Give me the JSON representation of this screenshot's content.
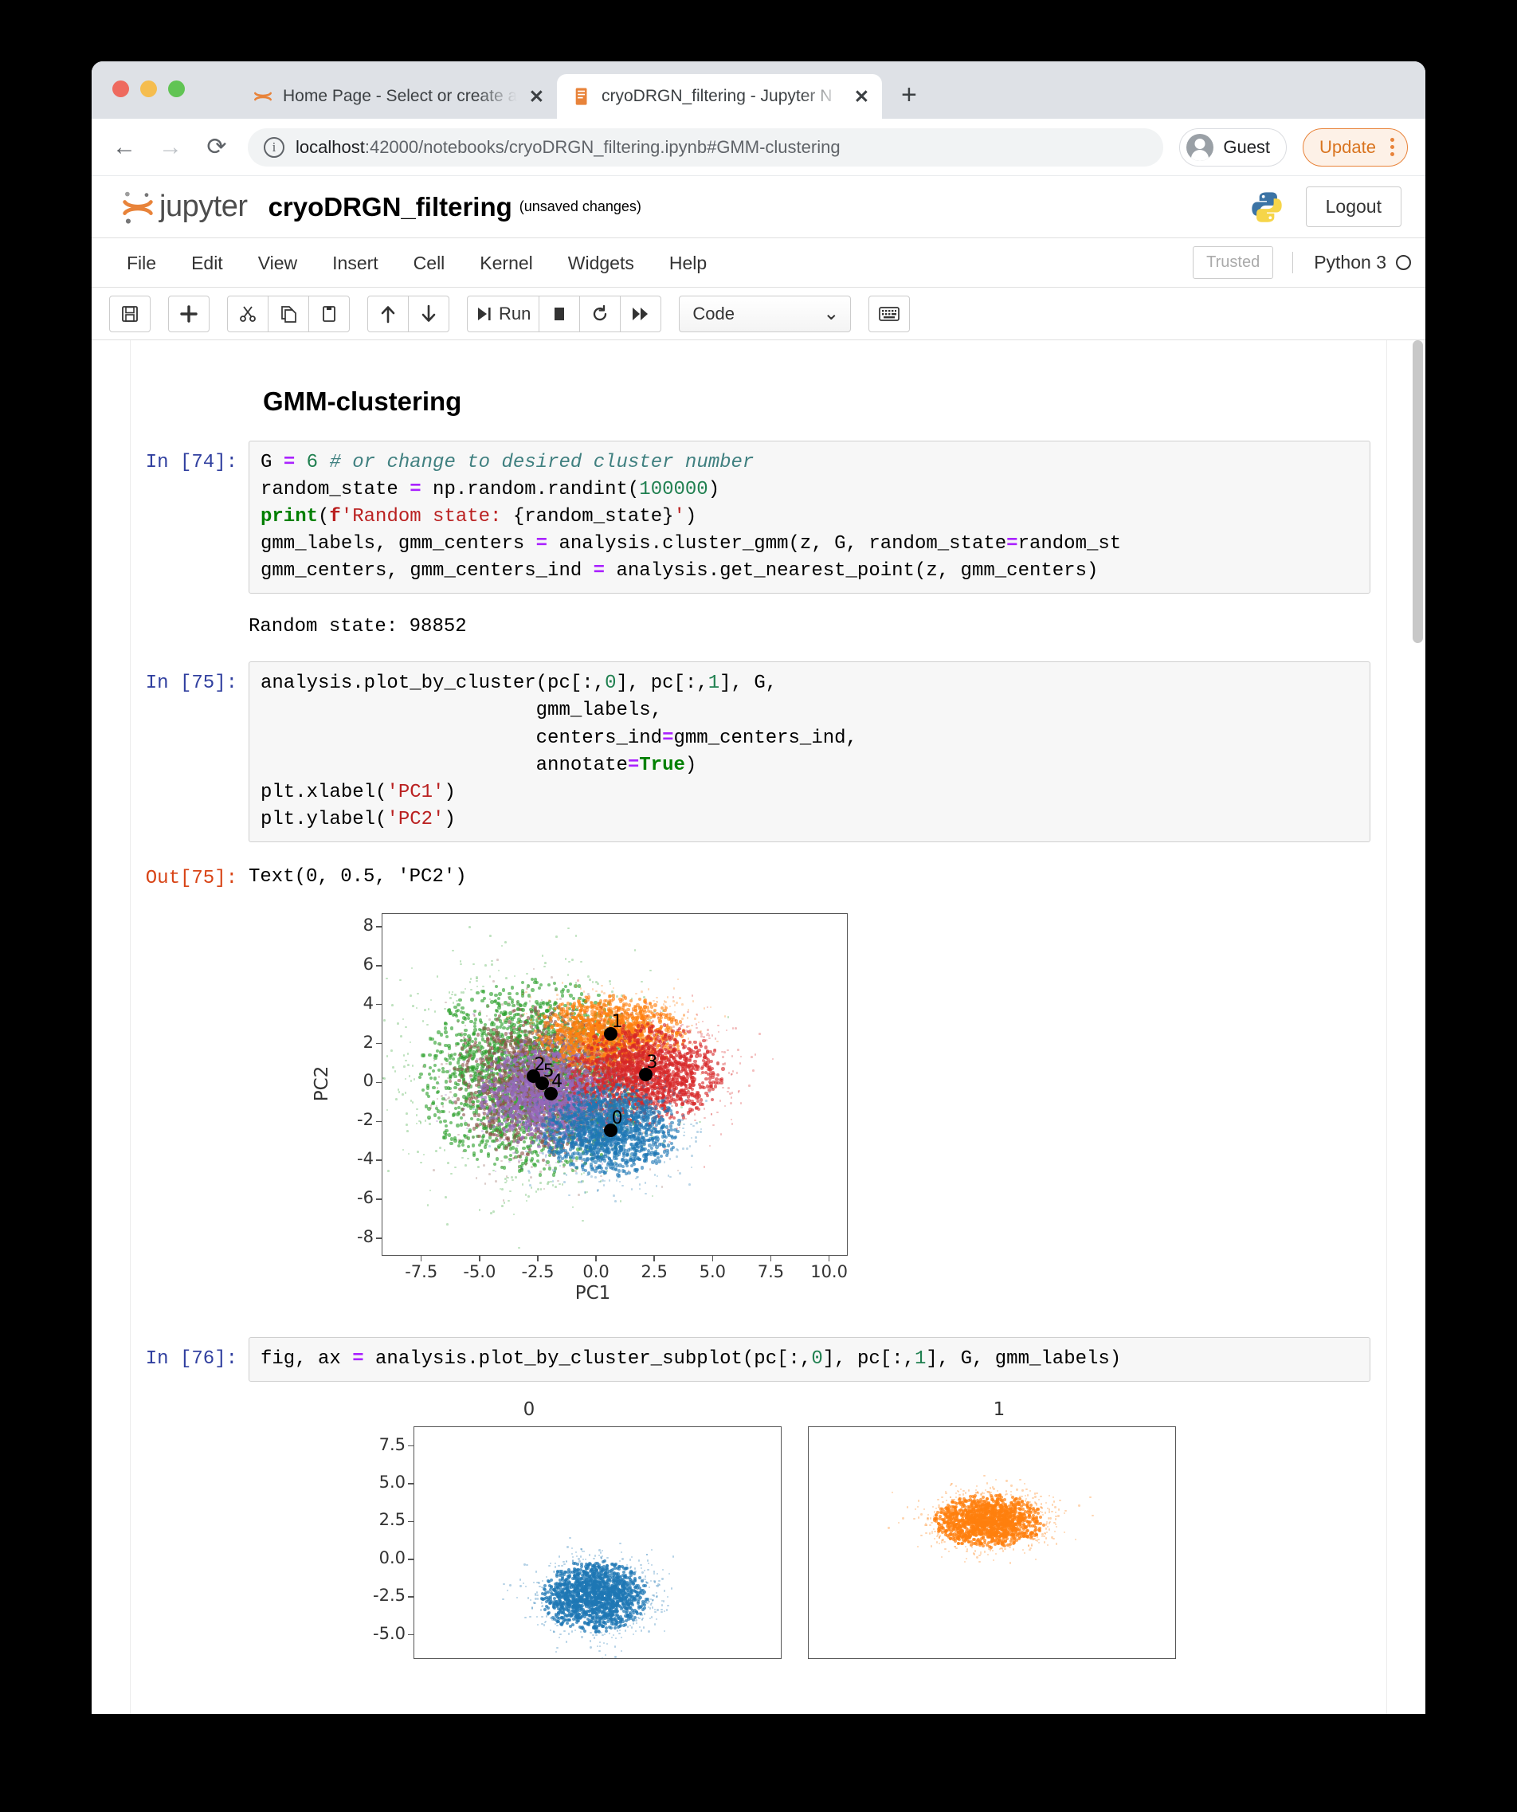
{
  "browser": {
    "tabs": [
      {
        "title": "Home Page - Select or create a",
        "favicon": "jupyter-spinner-icon",
        "active": false,
        "close": "✕"
      },
      {
        "title": "cryoDRGN_filtering - Jupyter N",
        "favicon": "jupyter-notebook-icon",
        "active": true,
        "close": "✕"
      }
    ],
    "new_tab_label": "+",
    "back_icon": "←",
    "forward_icon": "→",
    "reload_icon": "⟳",
    "url_host": "localhost",
    "url_rest": ":42000/notebooks/cryoDRGN_filtering.ipynb#GMM-clustering",
    "profile_label": "Guest",
    "update_label": "Update",
    "accent_orange": "#e8833a"
  },
  "jupyter": {
    "logo_text": "jupyter",
    "notebook_name": "cryoDRGN_filtering",
    "save_state": "(unsaved changes)",
    "logout_label": "Logout",
    "menus": [
      "File",
      "Edit",
      "View",
      "Insert",
      "Cell",
      "Kernel",
      "Widgets",
      "Help"
    ],
    "trusted_label": "Trusted",
    "kernel_label": "Python 3",
    "toolbar": {
      "save_icon": "💾",
      "insert_icon": "+",
      "cut_icon": "✂",
      "copy_icon": "⧉",
      "paste_icon": "📋",
      "up_icon": "↑",
      "down_icon": "↓",
      "run_label": "Run",
      "run_icon": "▶|",
      "stop_icon": "■",
      "restart_icon": "↻",
      "restart_run_all_icon": "⏩",
      "cell_type": "Code",
      "cell_type_caret": "⌄",
      "keyboard_icon": "⌨"
    }
  },
  "notebook": {
    "heading": "GMM-clustering",
    "cells": [
      {
        "prompt": "In [74]:",
        "type": "code",
        "lines": [
          "G = 6 # or change to desired cluster number",
          "random_state = np.random.randint(100000)",
          "print(f'Random state: {random_state}')",
          "gmm_labels, gmm_centers = analysis.cluster_gmm(z, G, random_state=random_st",
          "gmm_centers, gmm_centers_ind = analysis.get_nearest_point(z, gmm_centers)"
        ]
      },
      {
        "prompt": "",
        "type": "stdout",
        "text": "Random state: 98852"
      },
      {
        "prompt": "In [75]:",
        "type": "code",
        "lines": [
          "analysis.plot_by_cluster(pc[:,0], pc[:,1], G,",
          "                        gmm_labels,",
          "                        centers_ind=gmm_centers_ind,",
          "                        annotate=True)",
          "plt.xlabel('PC1')",
          "plt.ylabel('PC2')"
        ]
      },
      {
        "prompt": "Out[75]:",
        "type": "result",
        "text": "Text(0, 0.5, 'PC2')"
      },
      {
        "prompt": "In [76]:",
        "type": "code",
        "lines": [
          "fig, ax = analysis.plot_by_cluster_subplot(pc[:,0], pc[:,1], G, gmm_labels)"
        ]
      }
    ]
  },
  "chart_data": [
    {
      "type": "scatter",
      "title": "",
      "xlabel": "PC1",
      "ylabel": "PC2",
      "xlim": [
        -9.2,
        10.8
      ],
      "ylim": [
        -8.9,
        8.7
      ],
      "xticks": [
        -7.5,
        -5.0,
        -2.5,
        0.0,
        2.5,
        5.0,
        7.5,
        10.0
      ],
      "xticklabels": [
        "-7.5",
        "-5.0",
        "-2.5",
        "0.0",
        "2.5",
        "5.0",
        "7.5",
        "10.0"
      ],
      "yticks": [
        -8,
        -6,
        -4,
        -2,
        0,
        2,
        4,
        6,
        8
      ],
      "yticklabels": [
        "-8",
        "-6",
        "-4",
        "-2",
        "0",
        "2",
        "4",
        "6",
        "8"
      ],
      "grid": false,
      "legend": "none",
      "annotate_centers": true,
      "series": [
        {
          "name": "0",
          "color": "#1f77b4",
          "center": [
            0.6,
            -2.4
          ],
          "spread": [
            1.45,
            1.15
          ],
          "n": 1500
        },
        {
          "name": "1",
          "color": "#ff7f0e",
          "center": [
            0.6,
            2.55
          ],
          "spread": [
            1.55,
            0.95
          ],
          "n": 1400
        },
        {
          "name": "2",
          "color": "#2ca02c",
          "center": [
            -2.7,
            0.35
          ],
          "spread": [
            2.35,
            2.45
          ],
          "n": 2400
        },
        {
          "name": "3",
          "color": "#d62728",
          "center": [
            2.1,
            0.45
          ],
          "spread": [
            1.6,
            1.25
          ],
          "n": 1700
        },
        {
          "name": "4",
          "color": "#9467bd",
          "center": [
            -2.0,
            -0.5
          ],
          "spread": [
            1.45,
            1.35
          ],
          "n": 1500
        },
        {
          "name": "5",
          "color": "#8c564b",
          "center": [
            -2.3,
            0.0
          ],
          "spread": [
            1.9,
            1.9
          ],
          "n": 1500
        }
      ],
      "centers": [
        {
          "label": "0",
          "x": 0.6,
          "y": -2.4
        },
        {
          "label": "1",
          "x": 0.6,
          "y": 2.55
        },
        {
          "label": "2",
          "x": -2.72,
          "y": 0.35
        },
        {
          "label": "3",
          "x": 2.1,
          "y": 0.45
        },
        {
          "label": "4",
          "x": -1.98,
          "y": -0.52
        },
        {
          "label": "5",
          "x": -2.34,
          "y": 0.0
        }
      ]
    },
    {
      "type": "scatter",
      "title": "0",
      "xlabel": "",
      "ylabel": "",
      "ylim": [
        -6.6,
        8.8
      ],
      "yticks": [
        7.5,
        5.0,
        2.5,
        0.0,
        -2.5,
        -5.0
      ],
      "yticklabels": [
        "7.5",
        "5.0",
        "2.5",
        "0.0",
        "-2.5",
        "-5.0"
      ],
      "series": [
        {
          "name": "0",
          "color": "#1f77b4",
          "center": [
            0.6,
            -2.4
          ],
          "spread": [
            1.45,
            1.2
          ],
          "n": 1800
        }
      ]
    },
    {
      "type": "scatter",
      "title": "1",
      "xlabel": "",
      "ylabel": "",
      "ylim": [
        -6.6,
        8.8
      ],
      "series": [
        {
          "name": "1",
          "color": "#ff7f0e",
          "center": [
            0.6,
            2.55
          ],
          "spread": [
            1.5,
            0.9
          ],
          "n": 1700
        }
      ]
    }
  ]
}
